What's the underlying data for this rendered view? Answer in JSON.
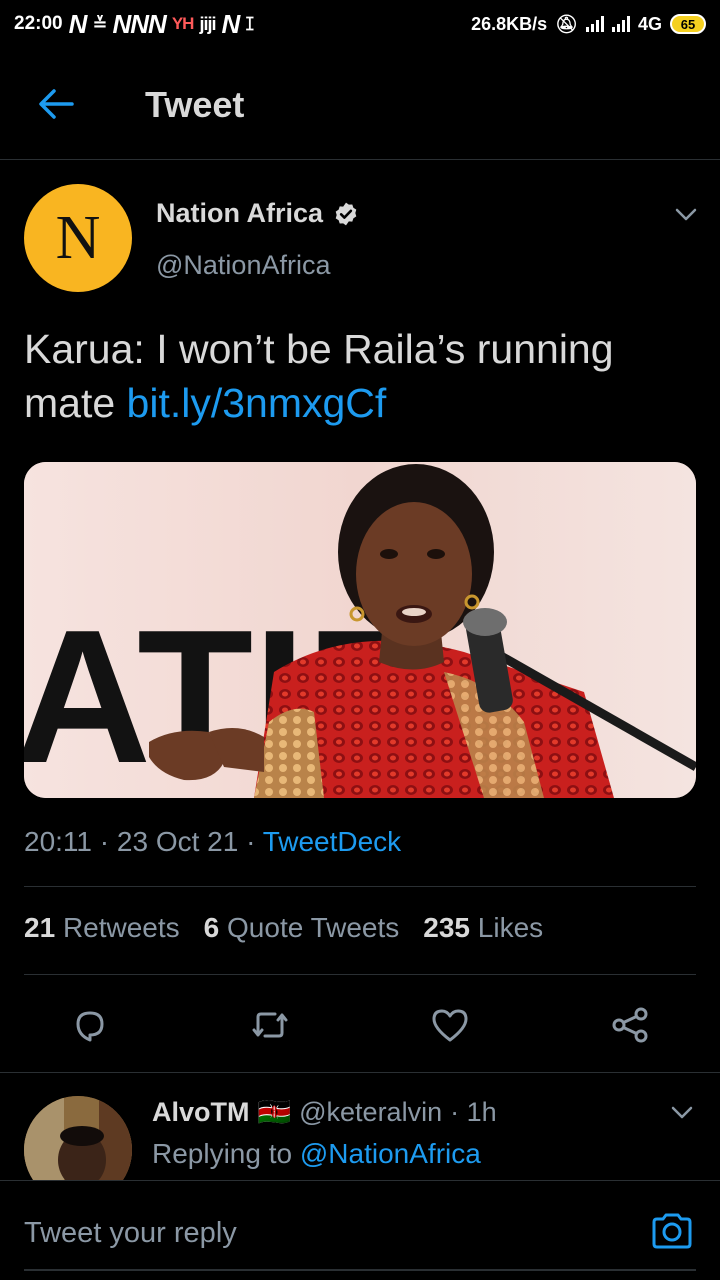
{
  "status_bar": {
    "time": "22:00",
    "left_icons": [
      "N",
      "≚",
      "NNN",
      "YH",
      "jiji",
      "N",
      "ꕯ"
    ],
    "speed": "26.8KB/s",
    "network": "4G",
    "battery": "65"
  },
  "header": {
    "title": "Tweet",
    "back_icon": "arrow-left-icon"
  },
  "tweet": {
    "avatar_letter": "N",
    "author_name": "Nation Africa",
    "author_handle": "@NationAfrica",
    "verified": true,
    "text": "Karua: I won’t be Raila’s running mate ",
    "link": "bit.ly/3nmxgCf",
    "media_text": "ATIR",
    "time": "20:11",
    "date": "23 Oct 21",
    "source": "TweetDeck",
    "stats": {
      "retweets_count": "21",
      "retweets_label": "Retweets",
      "quotes_count": "6",
      "quotes_label": "Quote Tweets",
      "likes_count": "235",
      "likes_label": "Likes"
    },
    "actions": [
      "reply-icon",
      "retweet-icon",
      "like-icon",
      "share-icon"
    ]
  },
  "reply": {
    "name": "AlvoTM",
    "flag": "🇰🇪",
    "handle": "@keteralvin",
    "time": "· 1h",
    "replying_prefix": "Replying to",
    "replying_to": "@NationAfrica"
  },
  "compose": {
    "placeholder": "Tweet your reply",
    "camera_icon": "camera-icon"
  },
  "colors": {
    "background": "#000000",
    "link": "#1d9bf0",
    "text": "#d9d9d9",
    "secondary": "#8b98a5",
    "avatar_brand": "#f9b521"
  }
}
